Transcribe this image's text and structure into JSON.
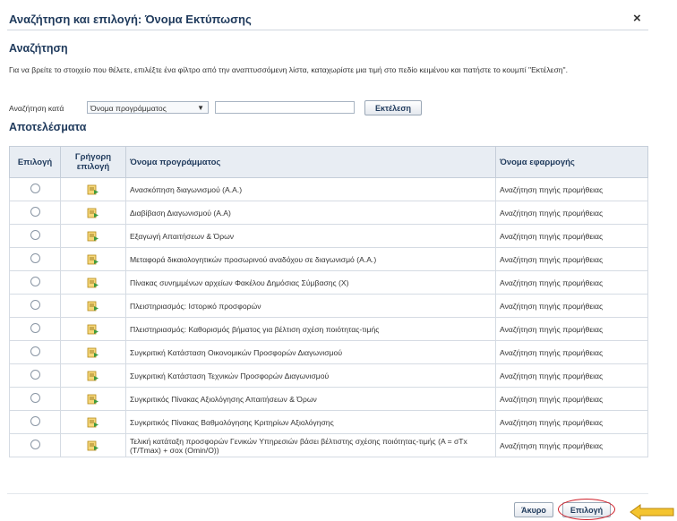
{
  "dialog": {
    "title": "Αναζήτηση και επιλογή: Όνομα Εκτύπωσης",
    "close_glyph": "×"
  },
  "search": {
    "heading": "Αναζήτηση",
    "instructions": "Για να βρείτε το στοιχείο που θέλετε, επιλέξτε ένα φίλτρο από την αναπτυσσόμενη λίστα, καταχωρίστε μια τιμή στο πεδίο κειμένου και πατήστε το κουμπί \"Εκτέλεση\".",
    "by_label": "Αναζήτηση κατά",
    "filter_value": "Όνομα προγράμματος",
    "text_value": "",
    "go_label": "Εκτέλεση"
  },
  "results": {
    "heading": "Αποτελέσματα",
    "columns": [
      "Επιλογή",
      "Γρήγορη επιλογή",
      "Όνομα προγράμματος",
      "Όνομα εφαρμογής"
    ],
    "rows": [
      {
        "program": "Ανασκόπηση διαγωνισμού (Α.Α.)",
        "application": "Αναζήτηση πηγής προμήθειας"
      },
      {
        "program": "Διαβίβαση Διαγωνισμού (Α.Α)",
        "application": "Αναζήτηση πηγής προμήθειας"
      },
      {
        "program": "Εξαγωγή Απαιτήσεων & Όρων",
        "application": "Αναζήτηση πηγής προμήθειας"
      },
      {
        "program": "Μεταφορά δικαιολογητικών προσωρινού αναδόχου σε διαγωνισμό (Α.Α.)",
        "application": "Αναζήτηση πηγής προμήθειας"
      },
      {
        "program": "Πίνακας συνημμένων αρχείων Φακέλου Δημόσιας Σύμβασης (Χ)",
        "application": "Αναζήτηση πηγής προμήθειας"
      },
      {
        "program": "Πλειστηριασμός: Ιστορικό προσφορών",
        "application": "Αναζήτηση πηγής προμήθειας"
      },
      {
        "program": "Πλειστηριασμός: Καθορισμός βήματος για βέλτιση σχέση ποιότητας-τιμής",
        "application": "Αναζήτηση πηγής προμήθειας"
      },
      {
        "program": "Συγκριτική Κατάσταση Οικονομικών Προσφορών Διαγωνισμού",
        "application": "Αναζήτηση πηγής προμήθειας"
      },
      {
        "program": "Συγκριτική Κατάσταση Τεχνικών Προσφορών Διαγωνισμού",
        "application": "Αναζήτηση πηγής προμήθειας"
      },
      {
        "program": "Συγκριτικός Πίνακας Αξιολόγησης Απαιτήσεων & Όρων",
        "application": "Αναζήτηση πηγής προμήθειας"
      },
      {
        "program": "Συγκριτικός Πίνακας Βαθμολόγησης Κριτηρίων Αξιολόγησης",
        "application": "Αναζήτηση πηγής προμήθειας"
      },
      {
        "program": "Τελική κατάταξη προσφορών Γενικών Υπηρεσιών βάσει βέλτιστης σχέσης ποιότητας-τιμής (Α = σΤx (T/Tmax) + σox (Omin/O))",
        "application": "Αναζήτηση πηγής προμήθειας"
      }
    ]
  },
  "footer": {
    "cancel_label": "Άκυρο",
    "select_label": "Επιλογή"
  },
  "colors": {
    "accent": "#1f3a5c",
    "highlight_oval": "#d0202a",
    "arrow_fill": "#f4c430"
  },
  "icons": {
    "quick_select": "quick-select-icon",
    "close": "close-icon",
    "arrow": "arrow-left-icon"
  }
}
